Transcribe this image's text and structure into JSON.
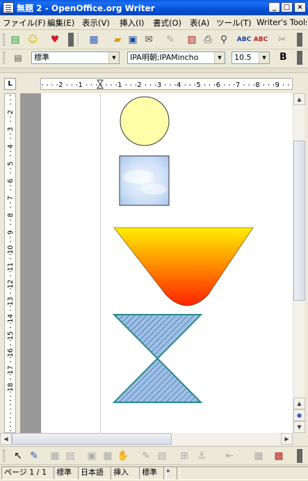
{
  "window": {
    "title": "無題 2 - OpenOffice.org Writer",
    "controls": {
      "minimize": "_",
      "maximize": "□",
      "close": "×"
    }
  },
  "menubar": {
    "items": [
      "ファイル(F)",
      "編集(E)",
      "表示(V)",
      "挿入(I)",
      "書式(O)",
      "表(A)",
      "ツール(T)",
      "Writer's Tools"
    ]
  },
  "formatting": {
    "paragraph_style": "標準",
    "font_name": "IPA明朝;IPAMincho",
    "font_size": "10.5",
    "bold_label": "B"
  },
  "ruler": {
    "corner_label": "L",
    "horizontal_ticks": [
      "2",
      "1",
      "1",
      "2",
      "3",
      "4",
      "5",
      "6",
      "7",
      "8",
      "9"
    ],
    "vertical_ticks": [
      "2",
      "3",
      "4",
      "5",
      "6",
      "7",
      "8",
      "9",
      "10",
      "11",
      "12",
      "13",
      "14",
      "15",
      "16",
      "17",
      "18"
    ]
  },
  "shapes": {
    "circle_fill": "#ffffaa",
    "square_fill": "#c8dcf5",
    "bowl_gradient": [
      "#ffee00",
      "#ff2200"
    ],
    "hourglass_fill": "#9cbfe8",
    "hourglass_stroke": "#248a8a"
  },
  "statusbar": {
    "page": "ページ 1 / 1",
    "style": "標準",
    "language": "日本語",
    "insert_mode": "挿入",
    "selection_mode": "標準",
    "modified": "*"
  },
  "colors": {
    "titlebar": "#0a5ce3",
    "chrome": "#ece9d8"
  }
}
